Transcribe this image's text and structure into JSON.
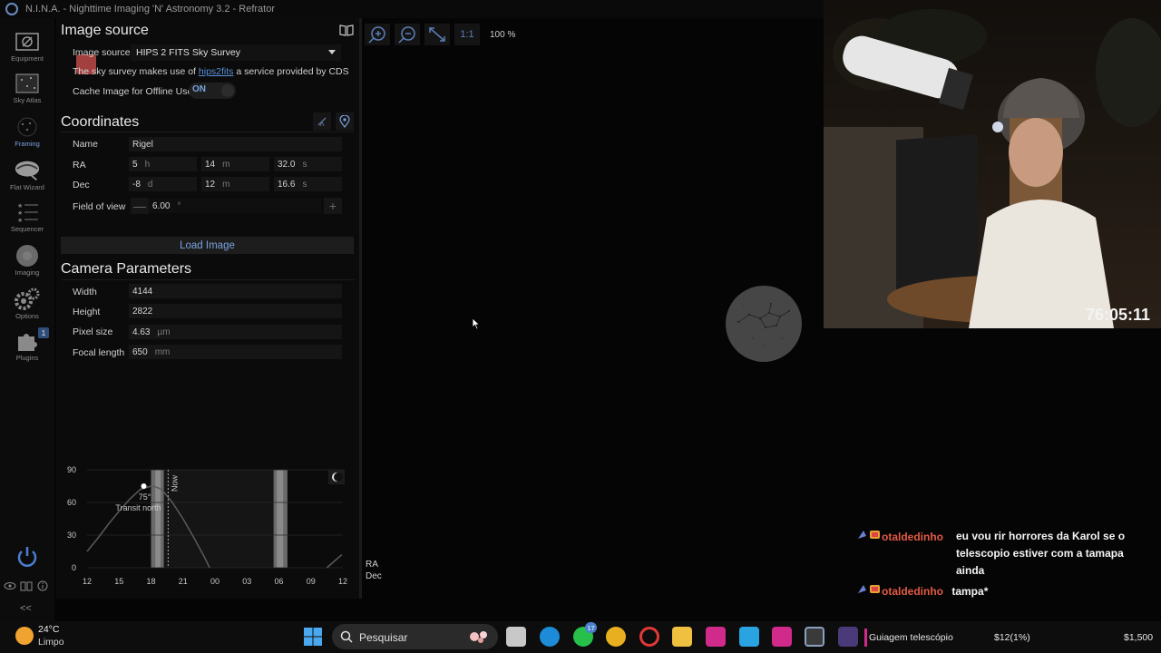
{
  "window": {
    "title": "N.I.N.A. - Nighttime Imaging 'N' Astronomy 3.2   -  Refrator"
  },
  "nav": {
    "items": [
      {
        "label": "Equipment"
      },
      {
        "label": "Sky Atlas"
      },
      {
        "label": "Framing"
      },
      {
        "label": "Flat Wizard"
      },
      {
        "label": "Sequencer"
      },
      {
        "label": "Imaging"
      },
      {
        "label": "Options"
      },
      {
        "label": "Plugins"
      }
    ],
    "plugins_badge": "1",
    "collapse": "<<"
  },
  "image_source": {
    "title": "Image source",
    "source_label": "Image source",
    "source_value": "HIPS 2 FITS Sky Survey",
    "survey_text_before": "The sky survey makes use of ",
    "survey_link": "hips2fits",
    "survey_text_after": " a service provided by CDS",
    "cache_label": "Cache Image for Offline Use",
    "cache_toggle": "ON"
  },
  "coordinates": {
    "title": "Coordinates",
    "name_label": "Name",
    "name_value": "Rigel",
    "ra_label": "RA",
    "ra_h": "5",
    "ra_h_unit": "h",
    "ra_m": "14",
    "ra_m_unit": "m",
    "ra_s": "32.0",
    "ra_s_unit": "s",
    "dec_label": "Dec",
    "dec_d": "-8",
    "dec_d_unit": "d",
    "dec_m": "12",
    "dec_m_unit": "m",
    "dec_s": "16.6",
    "dec_s_unit": "s",
    "fov_label": "Field of view",
    "fov_value": "6.00",
    "fov_unit": "°",
    "load_button": "Load Image"
  },
  "camera": {
    "title": "Camera Parameters",
    "width_label": "Width",
    "width_value": "4144",
    "height_label": "Height",
    "height_value": "2822",
    "pixel_label": "Pixel size",
    "pixel_value": "4.63",
    "pixel_unit": "µm",
    "focal_label": "Focal length",
    "focal_value": "650",
    "focal_unit": "mm"
  },
  "chart_data": {
    "type": "line",
    "title": "",
    "xlabel": "",
    "ylabel": "",
    "x_ticks": [
      "12",
      "15",
      "18",
      "21",
      "00",
      "03",
      "06",
      "09",
      "12"
    ],
    "y_ticks": [
      "0",
      "30",
      "60",
      "90"
    ],
    "ylim": [
      0,
      90
    ],
    "series": [
      {
        "x": [
          12,
          13,
          14,
          15,
          16,
          17,
          18,
          18.5,
          19,
          20,
          21,
          22,
          23,
          23.5
        ],
        "y": [
          15,
          27,
          40,
          52,
          63,
          72,
          75,
          74,
          72,
          60,
          45,
          28,
          10,
          0
        ]
      },
      {
        "x": [
          34.5,
          35.9
        ],
        "y": [
          0,
          12
        ]
      }
    ],
    "peak_annotation": "75°",
    "transit_label": "Transit north",
    "now_label": "Now"
  },
  "image_area": {
    "zoom_level": "100 %",
    "fit_label": "1:1",
    "ra_label": "RA",
    "dec_label": "Dec"
  },
  "stream": {
    "timer": "76:05:11",
    "chat": [
      {
        "user": "otaldedinho",
        "message": "eu vou rir horrores da Karol se o telescopio estiver com a tamapa ainda"
      },
      {
        "user": "otaldedinho",
        "message": "tampa*"
      }
    ]
  },
  "taskbar": {
    "temp": "24°C",
    "condition": "Limpo",
    "search_placeholder": "Pesquisar",
    "whatsapp_badge": "17",
    "media_title": "Guiagem telescópio",
    "stock_1": "$12(1%)",
    "stock_2": "$1,500"
  }
}
